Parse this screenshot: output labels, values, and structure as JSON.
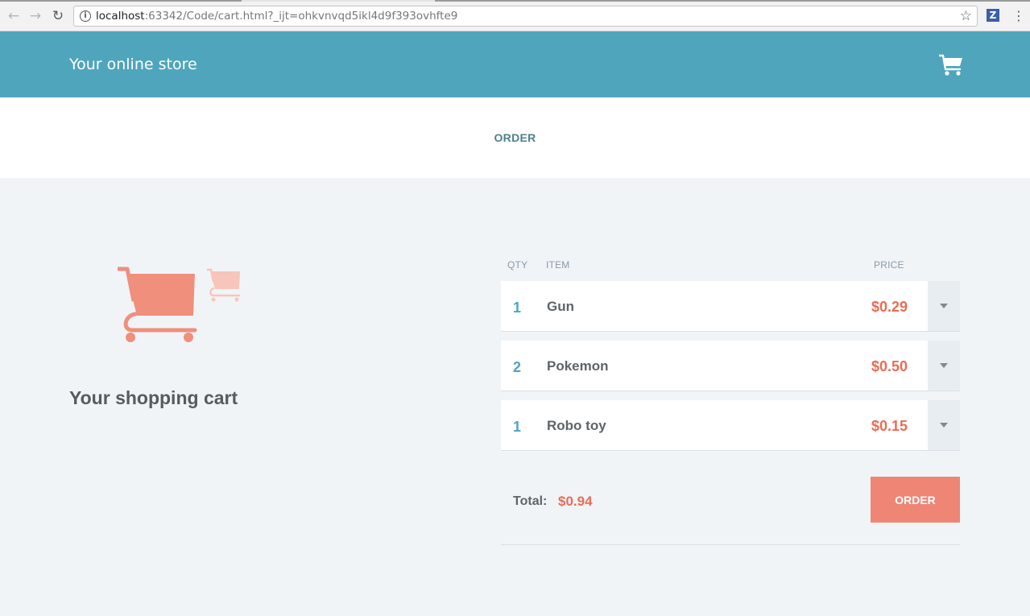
{
  "browser": {
    "url_host": "localhost",
    "url_rest": ":63342/Code/cart.html?_ijt=ohkvnvqd5ikl4d9f393ovhfte9",
    "extension_label": "Z"
  },
  "header": {
    "brand": "Your online store",
    "cart_icon": "shopping-cart-icon"
  },
  "nav": {
    "order_link": "ORDER"
  },
  "hero": {
    "title": "Your shopping cart",
    "illustration": "shopping-cart-illustration"
  },
  "table": {
    "headers": {
      "qty": "QTY",
      "item": "ITEM",
      "price": "PRICE"
    },
    "rows": [
      {
        "qty": "1",
        "item": "Gun",
        "price": "$0.29"
      },
      {
        "qty": "2",
        "item": "Pokemon",
        "price": "$0.50"
      },
      {
        "qty": "1",
        "item": "Robo toy",
        "price": "$0.15"
      }
    ]
  },
  "summary": {
    "total_label": "Total:",
    "total_value": "$0.94",
    "order_button": "ORDER"
  },
  "colors": {
    "header_bg": "#4fa5bc",
    "accent": "#ef8574",
    "price": "#ea6c55"
  }
}
